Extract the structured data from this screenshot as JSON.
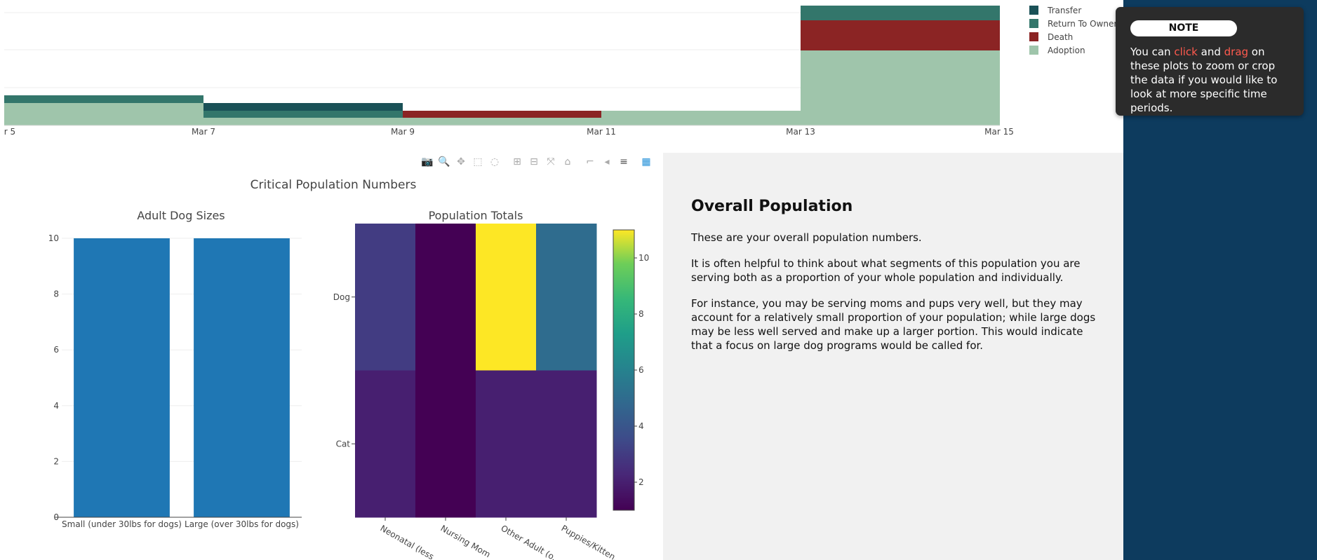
{
  "top_chart": {
    "x_ticks": [
      "r 5",
      "Mar 7",
      "Mar 9",
      "Mar 11",
      "Mar 13",
      "Mar 15"
    ],
    "legend": [
      {
        "name": "Transfer",
        "color": "#1a5157"
      },
      {
        "name": "Return To Owner",
        "color": "#33766b"
      },
      {
        "name": "Death",
        "color": "#8b2424"
      },
      {
        "name": "Adoption",
        "color": "#9fc5ab"
      }
    ]
  },
  "note": {
    "title": "NOTE",
    "text_1": "You can ",
    "word_click": "click",
    "text_2": " and ",
    "word_drag": "drag",
    "text_3": " on these plots to zoom or crop the data if you would like to look at more specific time periods."
  },
  "modebar": [
    {
      "name": "camera-icon",
      "glyph": "📷"
    },
    {
      "name": "zoom-icon",
      "glyph": "🔍"
    },
    {
      "name": "pan-icon",
      "glyph": "✥"
    },
    {
      "name": "box-select-icon",
      "glyph": "⬚"
    },
    {
      "name": "lasso-icon",
      "glyph": "◌"
    },
    {
      "name": "zoom-in-icon",
      "glyph": "⊞"
    },
    {
      "name": "zoom-out-icon",
      "glyph": "⊟"
    },
    {
      "name": "autoscale-icon",
      "glyph": "⤧"
    },
    {
      "name": "home-icon",
      "glyph": "⌂"
    },
    {
      "name": "spike-lines-icon",
      "glyph": "⌐"
    },
    {
      "name": "hover-closest-icon",
      "glyph": "◂"
    },
    {
      "name": "hover-compare-icon",
      "glyph": "≡"
    },
    {
      "name": "plotly-logo-icon",
      "glyph": "▦"
    }
  ],
  "figure_title": "Critical Population Numbers",
  "chart_data": [
    {
      "type": "bar",
      "title": "Adult Dog Sizes",
      "categories": [
        "Small (under 30lbs for dogs)",
        "Large (over 30lbs for dogs)"
      ],
      "values": [
        10,
        10
      ],
      "ylim": [
        0,
        10
      ],
      "y_ticks": [
        0,
        2,
        4,
        6,
        8,
        10
      ],
      "color": "#1f77b4"
    },
    {
      "type": "heatmap",
      "title": "Population Totals",
      "y_categories": [
        "Dog",
        "Cat"
      ],
      "x_categories": [
        "Neonatal (less ...",
        "Nursing Mom",
        "Other Adult (o...",
        "Puppies/Kitten..."
      ],
      "values": [
        [
          3,
          1,
          11,
          5
        ],
        [
          2,
          1,
          2,
          2
        ]
      ],
      "colorscale": "viridis",
      "zlim": [
        1,
        11
      ],
      "colorbar_ticks": [
        2,
        4,
        6,
        8,
        10
      ]
    }
  ],
  "text_panel": {
    "heading": "Overall Population",
    "p1": "These are your overall population numbers.",
    "p2": "It is often helpful to think about what segments of this population you are serving both as a proportion of your whole population and individually.",
    "p3": "For instance, you may be serving moms and pups very well, but they may account for a relatively small proportion of your population; while large dogs may be less well served and make up a larger portion. This would indicate that a focus on large dog programs would be called for."
  }
}
